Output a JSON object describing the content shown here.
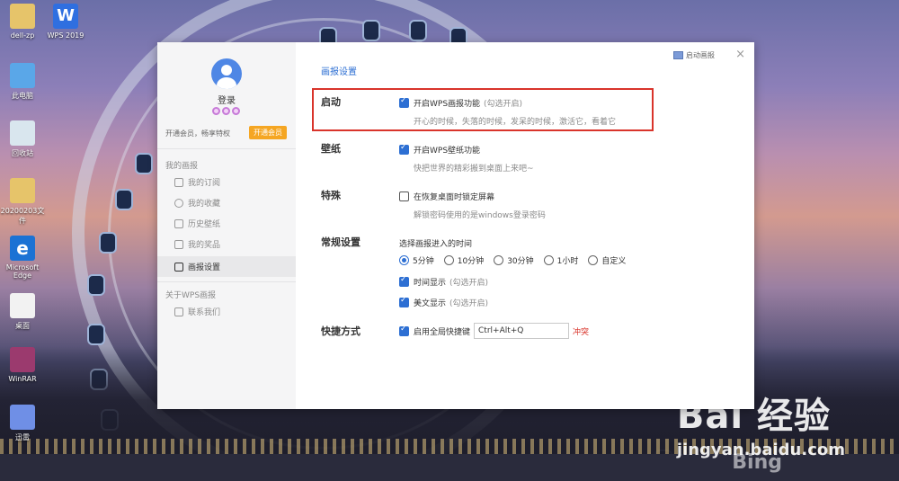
{
  "desktop": {
    "icons": [
      {
        "label": "dell-zp",
        "icon": "folder-icon"
      },
      {
        "label": "WPS 2019",
        "icon": "wps-icon"
      },
      {
        "label": "此电脑",
        "icon": "computer-icon"
      },
      {
        "label": "回收站",
        "icon": "recycle-bin-icon"
      },
      {
        "label": "20200203文件",
        "icon": "folder-icon"
      },
      {
        "label": "Microsoft Edge",
        "icon": "edge-icon"
      },
      {
        "label": "桌面",
        "icon": "file-icon"
      },
      {
        "label": "WinRAR",
        "icon": "winrar-icon"
      },
      {
        "label": "迅雷",
        "icon": "thunder-icon"
      }
    ]
  },
  "watermark": {
    "logo": "Bai 经验",
    "site": "jingyan.baidu.com",
    "bing": "Bing"
  },
  "window": {
    "top_link": "启动画报",
    "close_glyph": "×",
    "sidebar": {
      "login": "登录",
      "vip_text": "开通会员，畅享特权",
      "vip_button": "开通会员",
      "my_section": "我的画报",
      "items": [
        {
          "label": "我的订阅",
          "icon": "subscription-icon"
        },
        {
          "label": "我的收藏",
          "icon": "heart-icon"
        },
        {
          "label": "历史壁纸",
          "icon": "history-icon"
        },
        {
          "label": "我的奖品",
          "icon": "gift-icon"
        },
        {
          "label": "画报设置",
          "icon": "settings-sliders-icon",
          "active": true
        }
      ],
      "about_section": "关于WPS画报",
      "contact": {
        "label": "联系我们",
        "icon": "chat-icon"
      }
    },
    "main": {
      "title": "画报设置",
      "startup": {
        "label": "启动",
        "option": "开启WPS画报功能",
        "hint": "(勾选开启)",
        "checked": true,
        "desc": "开心的时候，失落的时候，发呆的时候，激活它，看着它"
      },
      "wallpaper": {
        "label": "壁纸",
        "option": "开启WPS壁纸功能",
        "checked": true,
        "desc": "快把世界的精彩搬到桌面上来吧~"
      },
      "special": {
        "label": "特殊",
        "option": "在恢复桌面时锁定屏幕",
        "checked": false,
        "desc": "解锁密码使用的是windows登录密码"
      },
      "general": {
        "label": "常规设置",
        "time_prompt": "选择画报进入的时间",
        "time_options": [
          "5分钟",
          "10分钟",
          "30分钟",
          "1小时",
          "自定义"
        ],
        "time_selected": "5分钟",
        "show_time": "时间显示",
        "show_time_hint": "(勾选开启)",
        "show_text": "美文显示",
        "show_text_hint": "(勾选开启)"
      },
      "shortcut": {
        "label": "快捷方式",
        "option": "启用全局快捷键",
        "checked": true,
        "value": "Ctrl+Alt+Q",
        "conflict": "冲突"
      }
    }
  }
}
